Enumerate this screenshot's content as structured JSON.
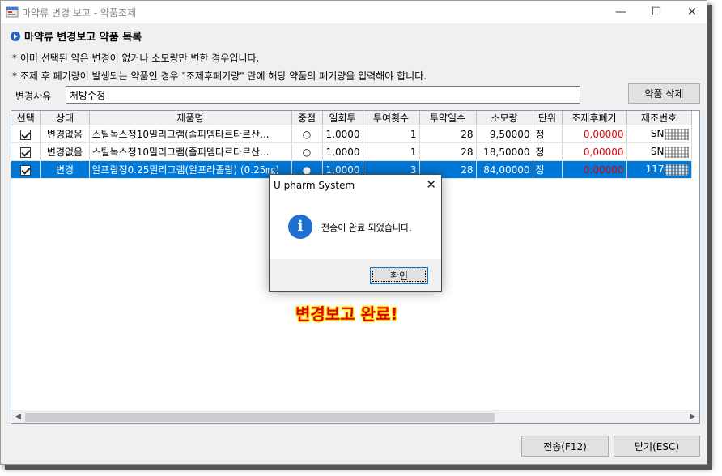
{
  "window": {
    "title": "마약류 변경 보고 - 약품조제",
    "min_glyph": "—",
    "max_glyph": "☐",
    "close_glyph": "✕"
  },
  "header": {
    "section_title": "마약류 변경보고 약품 목록",
    "note1": "* 이미 선택된 약은 변경이 없거나 소모량만 변한 경우입니다.",
    "note2": "* 조제 후 폐기량이 발생되는 약품인 경우 \"조제후폐기량\" 란에 해당 약품의 폐기량을 입력해야 합니다."
  },
  "reason": {
    "label": "변경사유",
    "value": "처방수정"
  },
  "buttons": {
    "delete": "약품 삭제",
    "send": "전송(F12)",
    "close": "닫기(ESC)"
  },
  "table": {
    "headers": [
      "선택",
      "상태",
      "제품명",
      "중점",
      "일회투",
      "투여횟수",
      "투약일수",
      "소모량",
      "단위",
      "조제후폐기",
      "제조번호"
    ],
    "rows": [
      {
        "status": "변경없음",
        "name": "스틸녹스정10밀리그램(졸피뎀타르타르산...",
        "mark": "○",
        "dose": "1,0000",
        "times": "1",
        "days": "28",
        "usage": "9,50000",
        "unit": "정",
        "waste": "0,00000",
        "lot": "SN"
      },
      {
        "status": "변경없음",
        "name": "스틸녹스정10밀리그램(졸피뎀타르타르산...",
        "mark": "○",
        "dose": "1,0000",
        "times": "1",
        "days": "28",
        "usage": "18,50000",
        "unit": "정",
        "waste": "0,00000",
        "lot": "SN"
      },
      {
        "status": "변경",
        "name": "알프람정0.25밀리그램(알프라졸람) (0.25㎎)",
        "mark": "●",
        "dose": "1,0000",
        "times": "3",
        "days": "28",
        "usage": "84,00000",
        "unit": "정",
        "waste": "0,00000",
        "lot": "117"
      }
    ]
  },
  "scroll": {
    "left": "◀",
    "right": "▶"
  },
  "dialog": {
    "title": "U pharm System",
    "close_glyph": "✕",
    "icon_glyph": "i",
    "message": "전송이 완료 되었습니다.",
    "ok": "확인"
  },
  "overlay": {
    "text": "변경보고 완료!"
  },
  "colors": {
    "selection": "#0078d7",
    "waste_red": "#e00000",
    "info_blue": "#1f6fd1",
    "overlay_red": "#e00000",
    "overlay_glow": "#ffe600"
  }
}
